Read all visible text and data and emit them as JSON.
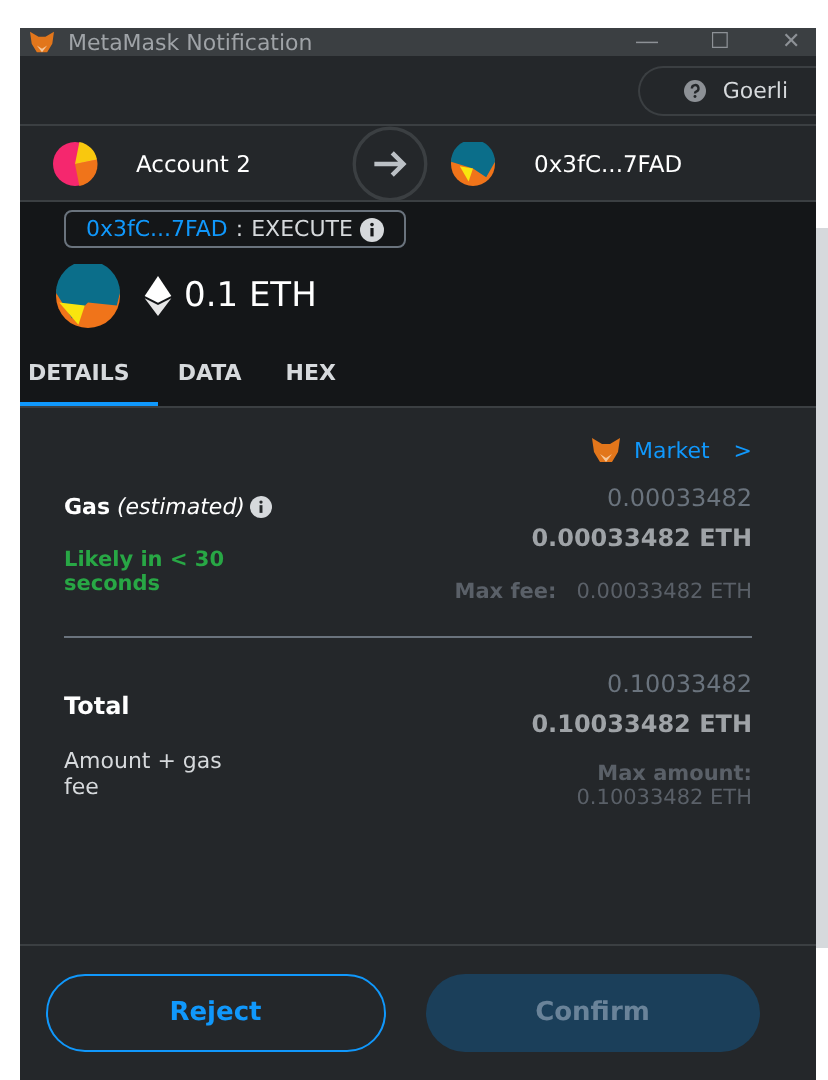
{
  "window": {
    "title": "MetaMask Notification",
    "controls": [
      "—",
      "☐",
      "✕"
    ]
  },
  "network": {
    "label": "Goerli"
  },
  "accounts": {
    "from": "Account 2",
    "to": "0x3fC...7FAD"
  },
  "method": {
    "address": "0x3fC...7FAD",
    "separator": ":",
    "action": "EXECUTE"
  },
  "amount": "0.1 ETH",
  "tabs": [
    {
      "label": "DETAILS",
      "selected": true
    },
    {
      "label": "DATA",
      "selected": false
    },
    {
      "label": "HEX",
      "selected": false
    }
  ],
  "market": {
    "label": "Market",
    "chevron": ">"
  },
  "gas": {
    "label": "**Gas** *(estimated)*",
    "value": "0.00033482",
    "value_eth": "0.00033482 ETH",
    "timing": "Likely in < 30 seconds",
    "max_label": "Max fee:",
    "max_value": "0.00033482 ETH"
  },
  "total": {
    "label": "Total",
    "value": "0.10033482",
    "value_eth": "0.10033482 ETH",
    "sublabel": "Amount + gas fee",
    "max_label": "Max amount:",
    "max_value": "0.10033482 ETH"
  },
  "buttons": [
    {
      "label": "Reject",
      "kind": "secondary",
      "disabled": false
    },
    {
      "label": "Confirm",
      "kind": "primary",
      "disabled": true
    }
  ]
}
